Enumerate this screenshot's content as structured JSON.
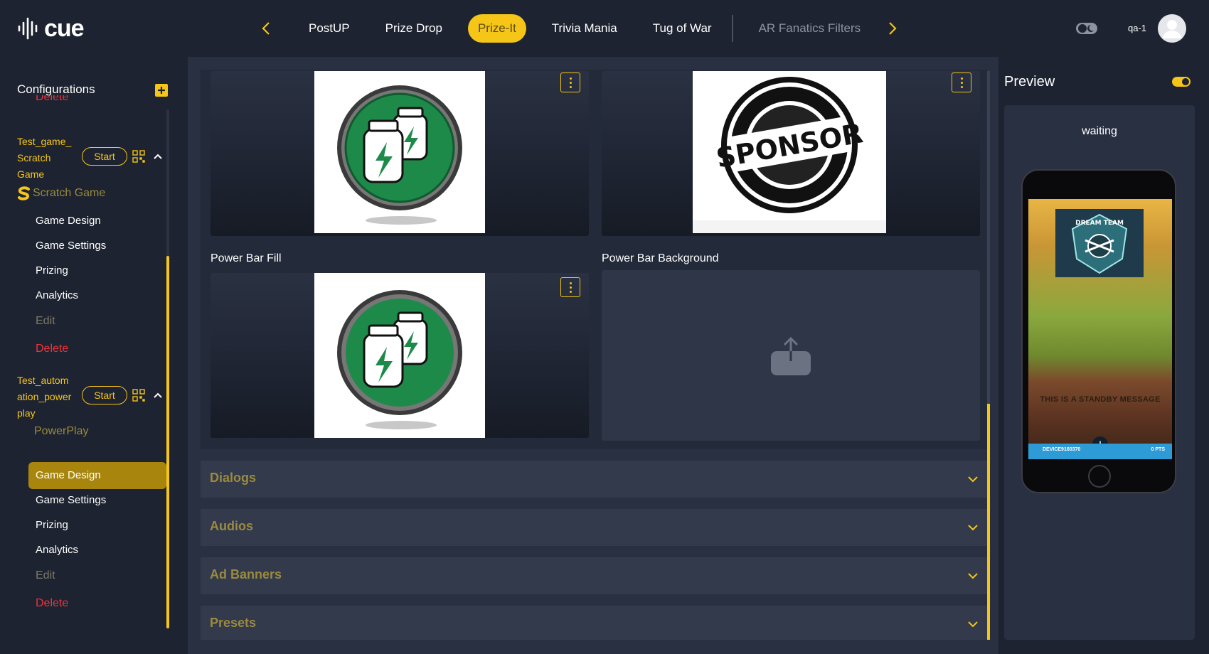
{
  "app": {
    "logo_text": "cue",
    "user_name": "qa-1"
  },
  "nav": {
    "tabs": [
      {
        "label": "PostUP",
        "active": false
      },
      {
        "label": "Prize Drop",
        "active": false
      },
      {
        "label": "Prize-It",
        "active": true
      },
      {
        "label": "Trivia Mania",
        "active": false
      },
      {
        "label": "Tug of War",
        "active": false
      },
      {
        "label": "AR Fanatics Filters",
        "active": false
      }
    ]
  },
  "sidebar": {
    "title": "Configurations",
    "clipped_top_label": "Delete",
    "configs": [
      {
        "name_lines": [
          "Test_game_",
          "Scratch",
          "Game"
        ],
        "start_label": "Start",
        "type_label": "Scratch Game",
        "items": [
          "Game Design",
          "Game Settings",
          "Prizing",
          "Analytics"
        ],
        "edit_label": "Edit",
        "delete_label": "Delete"
      },
      {
        "name_lines": [
          "Test_autom",
          "ation_power",
          "play"
        ],
        "start_label": "Start",
        "type_label": "PowerPlay",
        "items": [
          "Game Design",
          "Game Settings",
          "Prizing",
          "Analytics"
        ],
        "active_item": "Game Design",
        "edit_label": "Edit",
        "delete_label": "Delete"
      }
    ]
  },
  "assets": {
    "labels": {
      "fill": "Power Bar Fill",
      "background": "Power Bar Background"
    },
    "sponsor_stamp": "SPONSOR"
  },
  "accordions": [
    "Dialogs",
    "Audios",
    "Ad Banners",
    "Presets"
  ],
  "preview": {
    "title": "Preview",
    "status": "waiting",
    "standby_message": "THIS IS A STANDBY MESSAGE",
    "team_name": "DREAM TEAM",
    "footer_left": "DEVICE9160370",
    "footer_right": "0 PTS"
  },
  "colors": {
    "accent": "#f5c518",
    "background": "#1d2330",
    "panel": "#293041",
    "danger": "#f0333b"
  }
}
